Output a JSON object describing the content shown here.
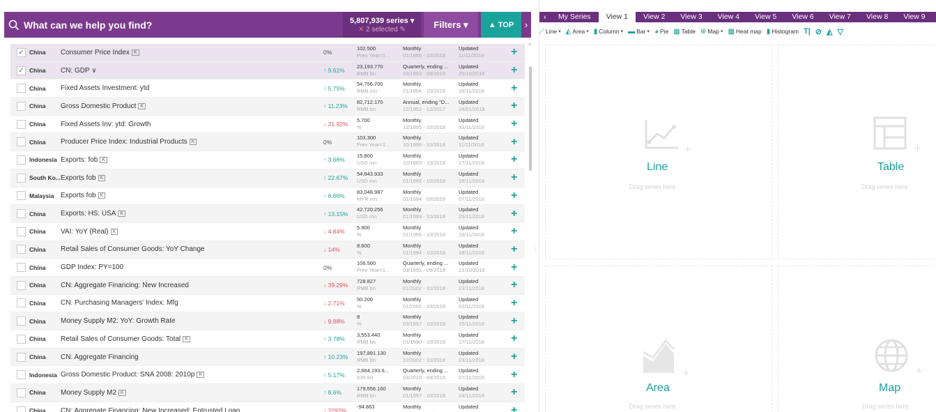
{
  "search": {
    "placeholder": "What can we help you find?",
    "series_count": "5,807,939 series",
    "selected": "2 selected",
    "filters_label": "Filters",
    "top_label": "TOP"
  },
  "rows": [
    {
      "country": "China",
      "name": "Consumer Price Index",
      "k": true,
      "change": "0%",
      "dir": "flat",
      "value": "102.500",
      "value_sub": "Prev Year=1...",
      "freq": "Monthly",
      "freq_sub": "01/1985 - 10/2018",
      "updated": "Updated",
      "updated_sub": "11/11/2018",
      "checked": true
    },
    {
      "country": "China",
      "name": "CN: GDP",
      "k": false,
      "chev": true,
      "change": "9.61%",
      "dir": "up",
      "value": "23,193.770",
      "value_sub": "RMB bn",
      "freq": "Quarterly, ending ...",
      "freq_sub": "03/1992 - 09/2018",
      "updated": "Updated",
      "updated_sub": "25/10/2018",
      "checked": true
    },
    {
      "country": "China",
      "name": "Fixed Assets Investment: ytd",
      "k": false,
      "change": "5.75%",
      "dir": "up",
      "value": "54,756.700",
      "value_sub": "RMB mn",
      "freq": "Monthly",
      "freq_sub": "01/1994 - 10/2018",
      "updated": "Updated",
      "updated_sub": "16/11/2018",
      "checked": false
    },
    {
      "country": "China",
      "name": "Gross Domestic Product",
      "k": true,
      "change": "11.23%",
      "dir": "up",
      "value": "82,712.170",
      "value_sub": "RMB bn",
      "freq": "Annual, ending \"D...",
      "freq_sub": "12/1952 - 12/2017",
      "updated": "Updated",
      "updated_sub": "24/01/2018",
      "checked": false
    },
    {
      "country": "China",
      "name": "Fixed Assets Inv: ytd: Growth",
      "k": false,
      "change": "21.92%",
      "dir": "down",
      "value": "5.700",
      "value_sub": "%",
      "freq": "Monthly",
      "freq_sub": "12/1995 - 10/2018",
      "updated": "Updated",
      "updated_sub": "16/11/2018",
      "checked": false
    },
    {
      "country": "China",
      "name": "Producer Price Index: Industrial Products",
      "k": true,
      "change": "0%",
      "dir": "flat",
      "value": "103.300",
      "value_sub": "Prev Year=1...",
      "freq": "Monthly",
      "freq_sub": "10/1996 - 10/2018",
      "updated": "Updated",
      "updated_sub": "11/11/2018",
      "checked": false
    },
    {
      "country": "Indonesia",
      "name": "Exports: fob",
      "k": true,
      "change": "3.66%",
      "dir": "up",
      "value": "15,800",
      "value_sub": "USD mn",
      "freq": "Monthly",
      "freq_sub": "10/1983 - 10/2018",
      "updated": "Updated",
      "updated_sub": "17/11/2018",
      "checked": false
    },
    {
      "country": "South Ko...",
      "name": "Exports fob",
      "k": true,
      "change": "22.67%",
      "dir": "up",
      "value": "54,943.933",
      "value_sub": "USD mn",
      "freq": "Monthly",
      "freq_sub": "01/1966 - 10/2018",
      "updated": "Updated",
      "updated_sub": "16/11/2018",
      "checked": false
    },
    {
      "country": "Malaysia",
      "name": "Exports fob",
      "k": true,
      "change": "6.66%",
      "dir": "up",
      "value": "83,048.987",
      "value_sub": "MYR mn",
      "freq": "Monthly",
      "freq_sub": "01/1984 - 09/2018",
      "updated": "Updated",
      "updated_sub": "07/11/2018",
      "checked": false
    },
    {
      "country": "China",
      "name": "Exports: HS: USA",
      "k": true,
      "change": "13.15%",
      "dir": "up",
      "value": "42,720.256",
      "value_sub": "USD mn",
      "freq": "Monthly",
      "freq_sub": "01/1993 - 10/2018",
      "updated": "Updated",
      "updated_sub": "25/11/2018",
      "checked": false
    },
    {
      "country": "China",
      "name": "VAI: YoY (Real)",
      "k": true,
      "change": "4.84%",
      "dir": "down",
      "value": "5.900",
      "value_sub": "%",
      "freq": "Monthly",
      "freq_sub": "01/1995 - 10/2018",
      "updated": "Updated",
      "updated_sub": "16/11/2018",
      "checked": false
    },
    {
      "country": "China",
      "name": "Retail Sales of Consumer Goods: YoY Change",
      "k": false,
      "change": "14%",
      "dir": "down",
      "value": "8.600",
      "value_sub": "%",
      "freq": "Monthly",
      "freq_sub": "01/1994 - 10/2018",
      "updated": "Updated",
      "updated_sub": "16/11/2018",
      "checked": false
    },
    {
      "country": "China",
      "name": "GDP Index: PY=100",
      "k": false,
      "change": "0%",
      "dir": "flat",
      "value": "106.500",
      "value_sub": "Prev Year=1...",
      "freq": "Quarterly, ending ...",
      "freq_sub": "03/1992 - 09/2018",
      "updated": "Updated",
      "updated_sub": "21/10/2018",
      "checked": false
    },
    {
      "country": "China",
      "name": "CN: Aggregate Financing: New Increased",
      "k": false,
      "change": "39.29%",
      "dir": "down",
      "value": "728.827",
      "value_sub": "RMB bn",
      "freq": "Monthly",
      "freq_sub": "01/2002 - 10/2018",
      "updated": "Updated",
      "updated_sub": "23/11/2018",
      "checked": false
    },
    {
      "country": "China",
      "name": "CN: Purchasing Managers' Index: Mfg",
      "k": false,
      "change": "2.71%",
      "dir": "down",
      "value": "50.200",
      "value_sub": "%",
      "freq": "Monthly",
      "freq_sub": "01/2005 - 10/2018",
      "updated": "Updated",
      "updated_sub": "02/11/2018",
      "checked": false
    },
    {
      "country": "China",
      "name": "Money Supply M2: YoY: Growth Rate",
      "k": false,
      "change": "9.88%",
      "dir": "down",
      "value": "8",
      "value_sub": "%",
      "freq": "Monthly",
      "freq_sub": "03/1997 - 10/2018",
      "updated": "Updated",
      "updated_sub": "15/11/2018",
      "checked": false
    },
    {
      "country": "China",
      "name": "Retail Sales of Consumer Goods: Total",
      "k": true,
      "change": "3.78%",
      "dir": "up",
      "value": "3,553.440",
      "value_sub": "RMB bn",
      "freq": "Monthly",
      "freq_sub": "01/1990 - 10/2018",
      "updated": "Updated",
      "updated_sub": "17/11/2018",
      "checked": false
    },
    {
      "country": "China",
      "name": "CN: Aggregate Financing",
      "k": false,
      "change": "10.23%",
      "dir": "up",
      "value": "197,891.130",
      "value_sub": "RMB bn",
      "freq": "Monthly",
      "freq_sub": "12/2002 - 10/2018",
      "updated": "Updated",
      "updated_sub": "23/11/2018",
      "checked": false
    },
    {
      "country": "Indonesia",
      "name": "Gross Domestic Product: SNA 2008: 2010p",
      "k": true,
      "change": "5.17%",
      "dir": "up",
      "value": "2,684,193.6...",
      "value_sub": "IDR bn",
      "freq": "Quarterly, ending ...",
      "freq_sub": "03/2010 - 09/2018",
      "updated": "Updated",
      "updated_sub": "07/11/2018",
      "checked": false
    },
    {
      "country": "China",
      "name": "Money Supply M2",
      "k": true,
      "change": "8.6%",
      "dir": "up",
      "value": "179,556.160",
      "value_sub": "RMB bn",
      "freq": "Monthly",
      "freq_sub": "01/1997 - 10/2018",
      "updated": "Updated",
      "updated_sub": "24/11/2018",
      "checked": false
    },
    {
      "country": "China",
      "name": "CN: Aggregate Financing: New Increased: Entrusted Loan",
      "k": false,
      "change": "2292%",
      "dir": "down",
      "value": "-94.863",
      "value_sub": "RMB bn",
      "freq": "Monthly",
      "freq_sub": "01/2002 - 10/2018",
      "updated": "Updated",
      "updated_sub": "23/11/2018",
      "checked": false
    }
  ],
  "tabs": [
    "My Series",
    "View 1",
    "View 2",
    "View 3",
    "View 4",
    "View 5",
    "View 6",
    "View 7",
    "View 8",
    "View 9"
  ],
  "active_tab": "View 1",
  "toolbar": [
    {
      "label": "Line",
      "caret": true,
      "icon": "line-chart-icon"
    },
    {
      "label": "Area",
      "caret": true,
      "icon": "area-chart-icon"
    },
    {
      "label": "Column",
      "caret": true,
      "icon": "column-chart-icon"
    },
    {
      "label": "Bar",
      "caret": true,
      "icon": "bar-chart-icon"
    },
    {
      "label": "Pie",
      "caret": false,
      "icon": "pie-chart-icon"
    },
    {
      "label": "Table",
      "caret": false,
      "icon": "table-icon"
    },
    {
      "label": "Map",
      "caret": true,
      "icon": "globe-icon"
    },
    {
      "label": "Heat map",
      "caret": false,
      "icon": "heatmap-icon"
    },
    {
      "label": "Histogram",
      "caret": false,
      "icon": "histogram-icon"
    }
  ],
  "cells": {
    "line": {
      "label": "Line",
      "hint": "Drag series here"
    },
    "table": {
      "label": "Table",
      "hint": "Drag series here"
    },
    "area": {
      "label": "Area",
      "hint": "Drag series here"
    },
    "map": {
      "label": "Map",
      "hint": "Drag series here"
    }
  },
  "colors": {
    "purple": "#7b3a8e",
    "teal": "#1aa39a",
    "red": "#e0525a"
  }
}
